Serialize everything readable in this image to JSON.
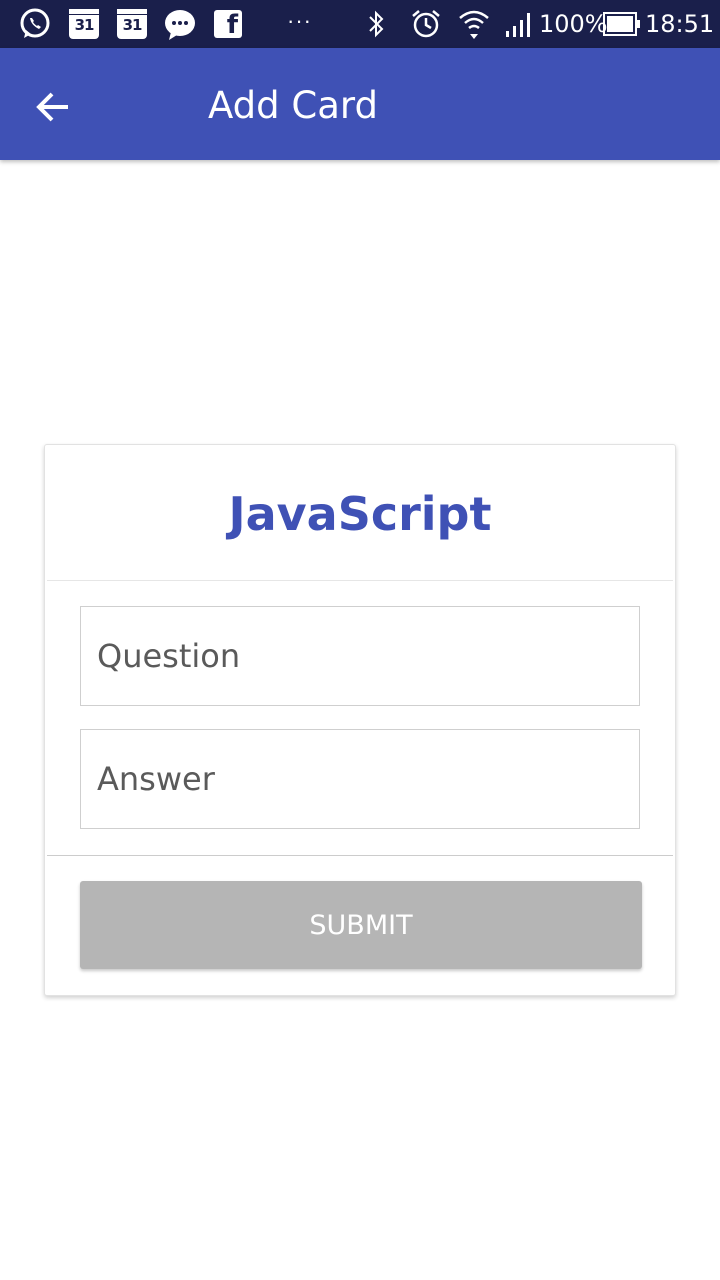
{
  "status_bar": {
    "calendar_day_1": "31",
    "calendar_day_2": "31",
    "facebook_glyph": "f",
    "more_dots": "···",
    "battery_text": "100%",
    "time": "18:51"
  },
  "app_bar": {
    "title": "Add Card",
    "background_color": "#3f51b5"
  },
  "card": {
    "title": "JavaScript",
    "question_placeholder": "Question",
    "answer_placeholder": "Answer",
    "question_value": "",
    "answer_value": "",
    "submit_label": "SUBMIT",
    "submit_state": "disabled"
  },
  "icons": [
    "whatsapp-icon",
    "calendar-icon",
    "calendar-icon",
    "messenger-icon",
    "facebook-icon",
    "bluetooth-icon",
    "alarm-icon",
    "wifi-icon",
    "signal-icon",
    "battery-icon",
    "back-arrow-icon"
  ]
}
